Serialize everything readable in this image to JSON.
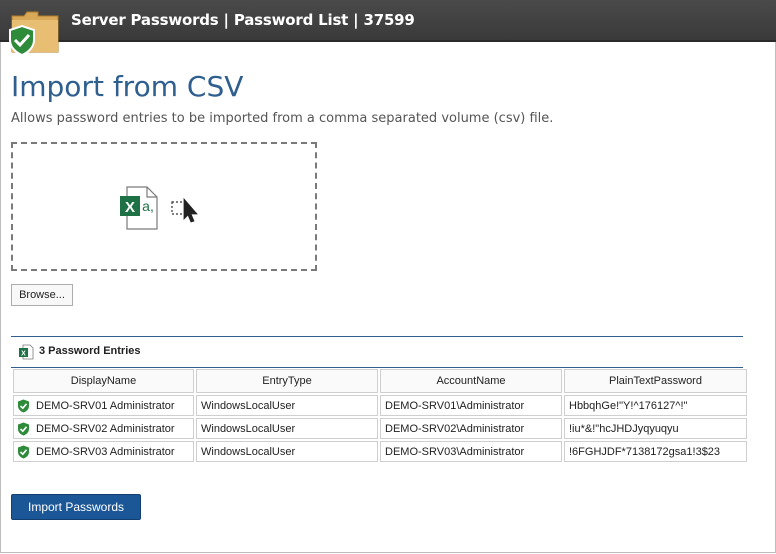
{
  "window": {
    "title": "Server Passwords | Password List | 37599"
  },
  "page": {
    "title": "Import from CSV",
    "description": "Allows password entries to be imported from a comma separated volume (csv) file."
  },
  "dropzone": {
    "file_icon": "excel-file-icon",
    "drag_icon": "drag-select-cursor-icon"
  },
  "browse": {
    "label": "Browse..."
  },
  "entries": {
    "summary": "3 Password Entries",
    "columns": [
      "DisplayName",
      "EntryType",
      "AccountName",
      "PlainTextPassword"
    ],
    "rows": [
      [
        "DEMO-SRV01 Administrator",
        "WindowsLocalUser",
        "DEMO-SRV01\\Administrator",
        "HbbqhGe!\"Y!^176127^!\""
      ],
      [
        "DEMO-SRV02 Administrator",
        "WindowsLocalUser",
        "DEMO-SRV02\\Administrator",
        "!iu*&!\"hcJHDJyqyuqyu"
      ],
      [
        "DEMO-SRV03 Administrator",
        "WindowsLocalUser",
        "DEMO-SRV03\\Administrator",
        "!6FGHJDF*7138172gsa1!3$23"
      ]
    ]
  },
  "actions": {
    "import_label": "Import Passwords"
  },
  "colors": {
    "accent": "#1b5796",
    "title": "#2f5f8f",
    "titlebar": "#3f3f3f",
    "shield": "#2e8b3a",
    "excel": "#1e7145"
  }
}
